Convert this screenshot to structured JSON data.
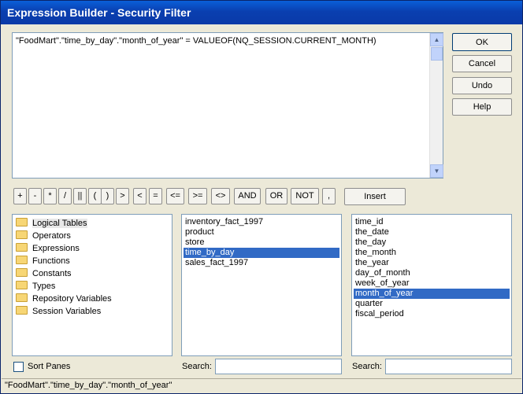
{
  "window": {
    "title": "Expression Builder - Security Filter"
  },
  "editor": {
    "expression": "\"FoodMart\".\"time_by_day\".\"month_of_year\" = VALUEOF(NQ_SESSION.CURRENT_MONTH)"
  },
  "buttons": {
    "ok": "OK",
    "cancel": "Cancel",
    "undo": "Undo",
    "help": "Help",
    "insert": "Insert"
  },
  "operators": [
    "+",
    "-",
    "*",
    "/",
    "||",
    "(",
    ")",
    ">",
    "<",
    "=",
    "<=",
    ">=",
    "<>",
    "AND",
    "OR",
    "NOT",
    ","
  ],
  "categories": [
    "Logical Tables",
    "Operators",
    "Expressions",
    "Functions",
    "Constants",
    "Types",
    "Repository Variables",
    "Session Variables"
  ],
  "tables": [
    "inventory_fact_1997",
    "product",
    "store",
    "time_by_day",
    "sales_fact_1997"
  ],
  "columns": [
    "time_id",
    "the_date",
    "the_day",
    "the_month",
    "the_year",
    "day_of_month",
    "week_of_year",
    "month_of_year",
    "quarter",
    "fiscal_period"
  ],
  "sort_panes": {
    "label": "Sort Panes"
  },
  "search": {
    "label": "Search:"
  },
  "status": {
    "text": "\"FoodMart\".\"time_by_day\".\"month_of_year\""
  }
}
